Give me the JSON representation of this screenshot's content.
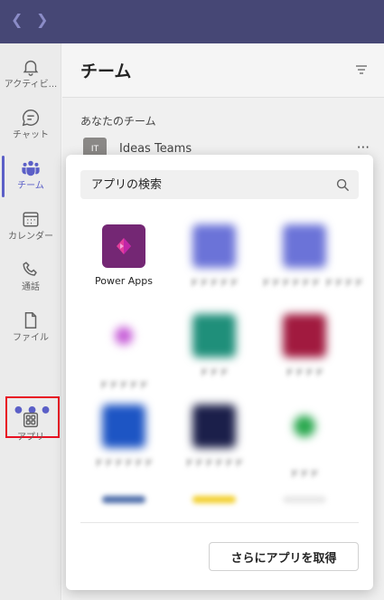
{
  "window": {
    "back_icon": "chevron-left-icon",
    "forward_icon": "chevron-right-icon"
  },
  "rail": {
    "items": [
      {
        "label": "アクティビ...",
        "icon": "bell-icon"
      },
      {
        "label": "チャット",
        "icon": "chat-icon"
      },
      {
        "label": "チーム",
        "icon": "teams-icon",
        "active": true
      },
      {
        "label": "カレンダー",
        "icon": "calendar-icon"
      },
      {
        "label": "通話",
        "icon": "phone-icon"
      },
      {
        "label": "ファイル",
        "icon": "file-icon"
      }
    ],
    "more": "•••",
    "apps_label": "アプリ"
  },
  "panel": {
    "title": "チーム",
    "section": "あなたのチーム",
    "team": {
      "avatar": "IT",
      "name": "Ideas Teams",
      "more": "···"
    }
  },
  "flyout": {
    "search_placeholder": "アプリの検索",
    "apps": [
      {
        "label": "Power Apps",
        "color": "#742774"
      },
      {
        "label": "ドドドドド",
        "color": "#6b73d8"
      },
      {
        "label": "ドドドドドド ドドドド",
        "color": "#6b73d8"
      },
      {
        "label": "ドドドドド",
        "color": "#c75fd8"
      },
      {
        "label": "ドドド",
        "color": "#1f8f7a"
      },
      {
        "label": "ドドドド",
        "color": "#a11a3f"
      },
      {
        "label": "ドドドドドド",
        "color": "#1d55c4"
      },
      {
        "label": "ドドドドドド",
        "color": "#1b1f4a"
      },
      {
        "label": "ドドド",
        "color": "#2aa84f"
      }
    ],
    "get_more": "さらにアプリを取得"
  },
  "colors": {
    "header": "#464775",
    "accent": "#5b5fc7",
    "highlight_border": "#e81123"
  }
}
